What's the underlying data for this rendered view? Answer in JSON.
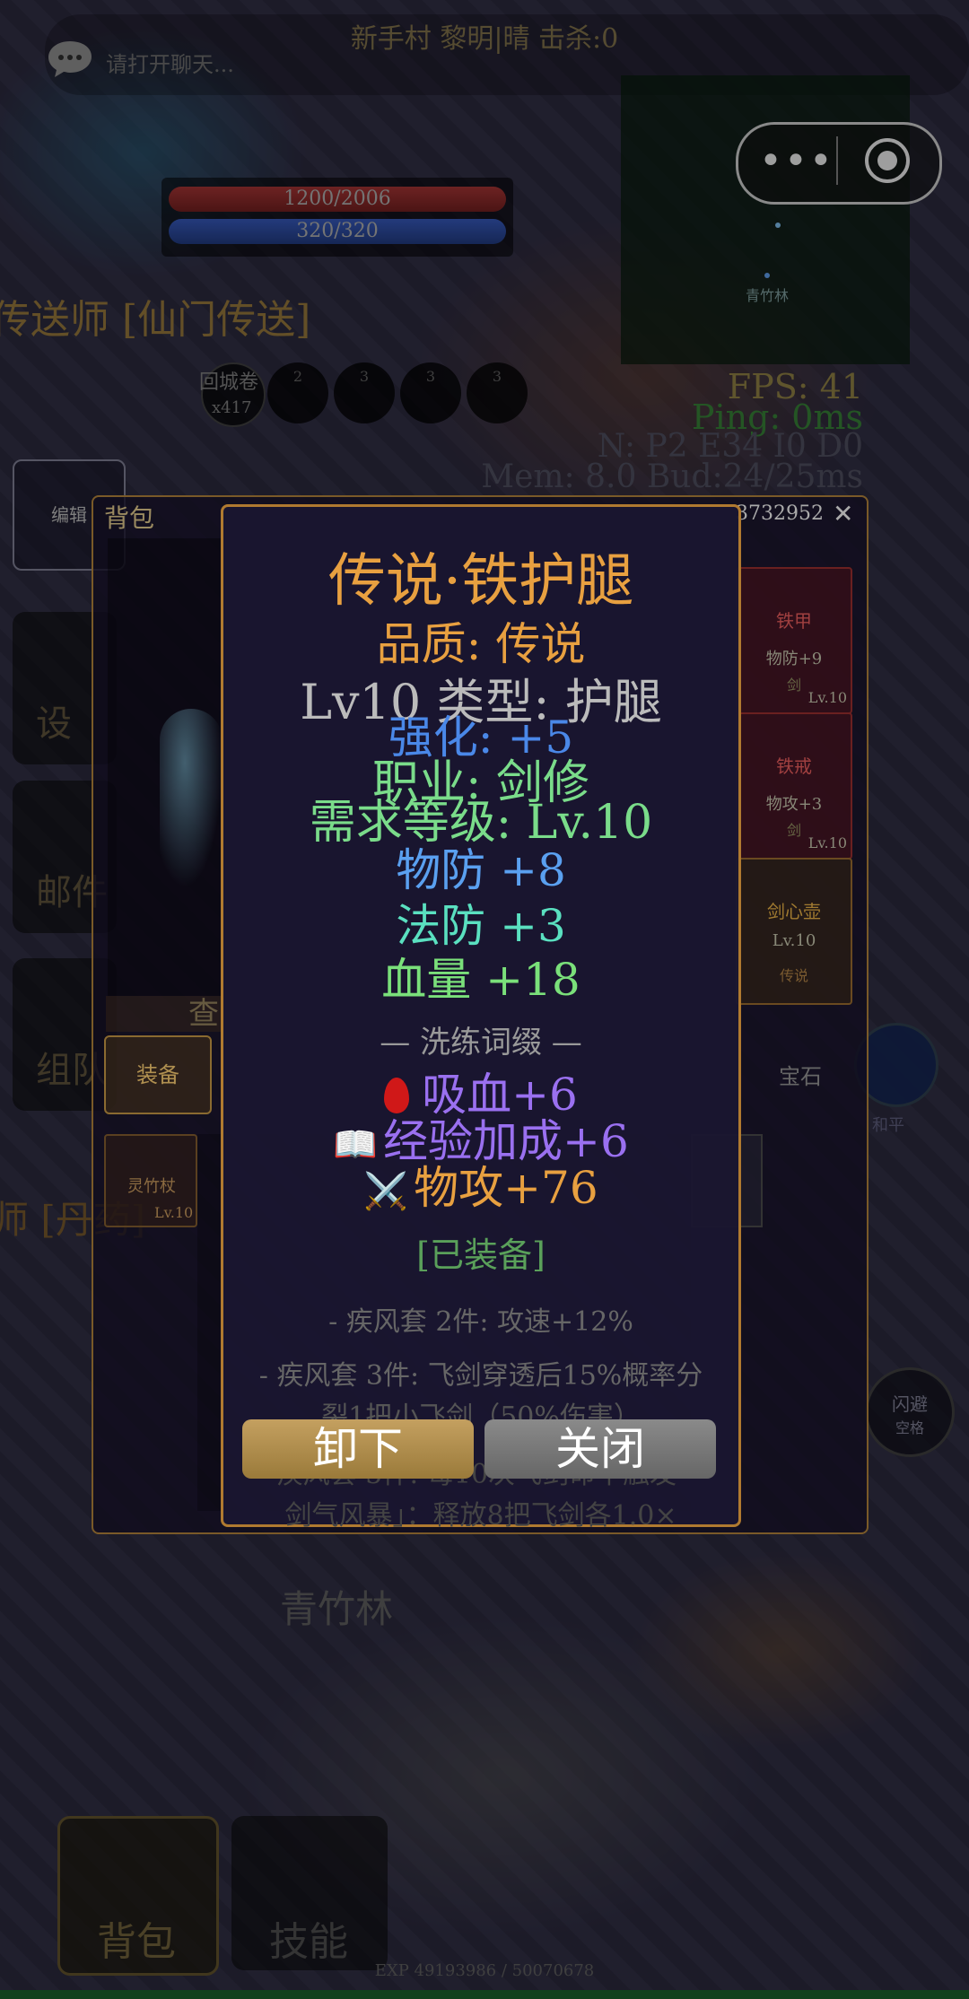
{
  "hud": {
    "zone_info": "新手村  黎明|晴  击杀:0",
    "chat_placeholder": "请打开聊天...",
    "hp_text": "1200/2006",
    "mp_text": "320/320",
    "minimap_label": "青竹林",
    "fps": "FPS: 41",
    "ping": "Ping: 0ms",
    "net": "N:   P2 E34 I0 D0",
    "mem": "Mem: 8.0 Bud:24/25ms",
    "scroll_label": "回城卷",
    "scroll_count": "x417",
    "skill_slots": [
      "2",
      "3",
      "3",
      "3",
      "3"
    ],
    "edit_label": "编辑",
    "side_buttons": [
      "设",
      "邮件",
      "组队"
    ],
    "peace_label": "和平",
    "dodge_label": "闪避",
    "dodge_key": "空格",
    "npc_teleport": "传送师 [仙门传送]",
    "npc_alchemy": "师 [丹药]",
    "area_name": "青竹林",
    "bottom_bag": "背包",
    "bottom_skill": "技能",
    "exp_text": "EXP 49193986 / 50070678"
  },
  "bag": {
    "title": "背包",
    "gold": "3732952",
    "close": "✕",
    "view_label": "查",
    "tab_equip": "装备",
    "tab_gem": "宝石",
    "item_name": "灵竹杖",
    "item_level": "Lv.10",
    "equipped_cards": [
      {
        "name": "铁甲",
        "stat": "物防+9",
        "kind": "剑",
        "level": "Lv.10"
      },
      {
        "name": "铁戒",
        "stat": "物攻+3",
        "kind": "剑",
        "level": "Lv.10"
      },
      {
        "name": "剑心壶",
        "stat": "Lv.10",
        "kind": "传说",
        "level": ""
      }
    ]
  },
  "tooltip": {
    "name": "传说·铁护腿",
    "quality": "品质: 传说",
    "type_line": "Lv10 类型: 护腿",
    "enhance": "强化: +5",
    "class": "职业: 剑修",
    "requirement": "需求等级: Lv.10",
    "pdef": "物防 +8",
    "mdef": "法防 +3",
    "hp": "血量 +18",
    "affix_header": "— 洗练词缀 —",
    "affix_1": "吸血+6",
    "affix_2": "经验加成+6",
    "affix_3": "物攻+76",
    "equipped": "[已装备]",
    "set_1": "- 疾风套 2件: 攻速+12%",
    "set_2": "- 疾风套 3件: 飞剑穿透后15%概率分",
    "set_2b": "裂1把小飞剑（50%伤害）",
    "set_3": "- 疾风套 5件: 每10次飞剑命中触发「",
    "set_3b": "剑气风暴」：释放8把飞剑各1.0×",
    "unequip_label": "卸下",
    "close_label": "关闭"
  },
  "colors": {
    "legendary": "#e8a040",
    "enhance": "#4a88e8",
    "requirement": "#7adc8a",
    "affix": "#9a70f0",
    "hp_bar": "#b03838",
    "mp_bar": "#3a5fc8"
  }
}
